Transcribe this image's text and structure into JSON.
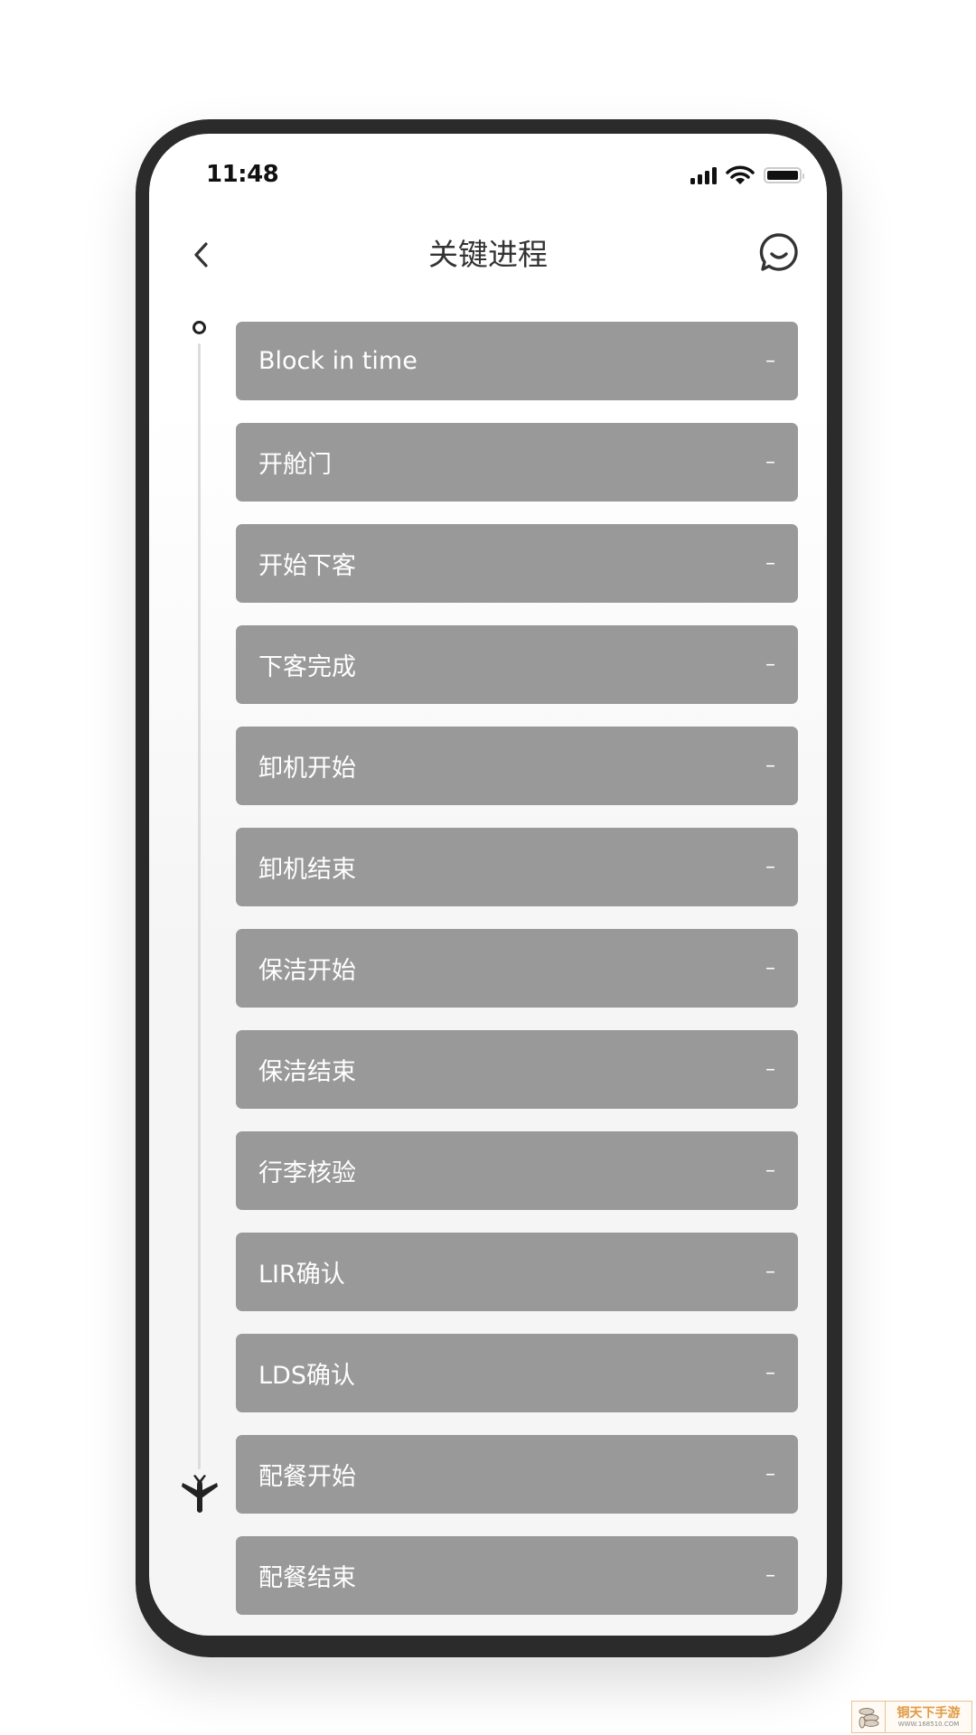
{
  "status_bar": {
    "time": "11:48",
    "signal": "signal-icon",
    "wifi": "wifi-icon",
    "battery": "battery-icon"
  },
  "header": {
    "back_icon": "chevron-left-icon",
    "title": "关键进程",
    "chat_icon": "chat-bubble-icon"
  },
  "timeline": {
    "start_icon": "circle-icon",
    "end_icon": "airplane-icon"
  },
  "milestones": [
    {
      "label": "Block in time",
      "value": "–"
    },
    {
      "label": "开舱门",
      "value": "–"
    },
    {
      "label": "开始下客",
      "value": "–"
    },
    {
      "label": "下客完成",
      "value": "–"
    },
    {
      "label": "卸机开始",
      "value": "–"
    },
    {
      "label": "卸机结束",
      "value": "–"
    },
    {
      "label": "保洁开始",
      "value": "–"
    },
    {
      "label": "保洁结束",
      "value": "–"
    },
    {
      "label": "行李核验",
      "value": "–"
    },
    {
      "label": "LIR确认",
      "value": "–"
    },
    {
      "label": "LDS确认",
      "value": "–"
    },
    {
      "label": "配餐开始",
      "value": "–"
    },
    {
      "label": "配餐结束",
      "value": "–"
    }
  ],
  "watermark": {
    "title": "铜天下手游",
    "url": "WWW.168510.COM"
  },
  "colors": {
    "card_bg": "#999999",
    "frame": "#2b2b2b",
    "text_dark": "#333333"
  }
}
